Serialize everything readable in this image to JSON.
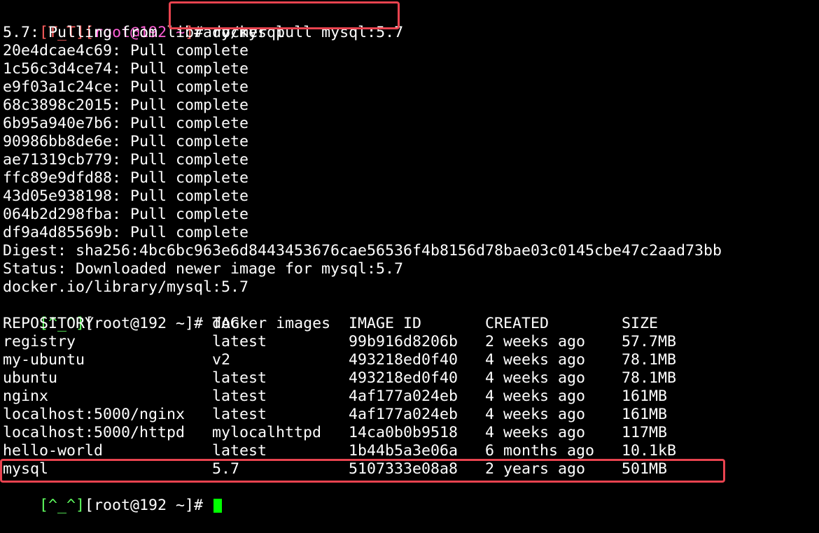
{
  "colors": {
    "background": "#000000",
    "text": "#ffffff",
    "prompt_error": "#ff5f5f",
    "prompt_error_user": "#ff5fd7",
    "prompt_ok": "#5fff5f",
    "cursor": "#00ff00",
    "highlight": "#e8434f"
  },
  "prompt1": {
    "open": "[",
    "face": "T_T",
    "close": "]",
    "user_open": "[",
    "user": "root@192 ~",
    "user_close": "]",
    "hash": "# ",
    "command": "docker pull mysql:5.7"
  },
  "pull_output": [
    "5.7: Pulling from library/mysql",
    "20e4dcae4c69: Pull complete",
    "1c56c3d4ce74: Pull complete",
    "e9f03a1c24ce: Pull complete",
    "68c3898c2015: Pull complete",
    "6b95a940e7b6: Pull complete",
    "90986bb8de6e: Pull complete",
    "ae71319cb779: Pull complete",
    "ffc89e9dfd88: Pull complete",
    "43d05e938198: Pull complete",
    "064b2d298fba: Pull complete",
    "df9a4d85569b: Pull complete",
    "Digest: sha256:4bc6bc963e6d8443453676cae56536f4b8156d78bae03c0145cbe47c2aad73bb",
    "Status: Downloaded newer image for mysql:5.7",
    "docker.io/library/mysql:5.7"
  ],
  "prompt2": {
    "face": "[^_^]",
    "user": "[root@192 ~]",
    "hash": "# ",
    "command": "docker images"
  },
  "images_table": {
    "headers": [
      "REPOSITORY",
      "TAG",
      "IMAGE ID",
      "CREATED",
      "SIZE"
    ],
    "rows": [
      [
        "registry",
        "latest",
        "99b916d8206b",
        "2 weeks ago",
        "57.7MB"
      ],
      [
        "my-ubuntu",
        "v2",
        "493218ed0f40",
        "4 weeks ago",
        "78.1MB"
      ],
      [
        "ubuntu",
        "latest",
        "493218ed0f40",
        "4 weeks ago",
        "78.1MB"
      ],
      [
        "nginx",
        "latest",
        "4af177a024eb",
        "4 weeks ago",
        "161MB"
      ],
      [
        "localhost:5000/nginx",
        "latest",
        "4af177a024eb",
        "4 weeks ago",
        "161MB"
      ],
      [
        "localhost:5000/httpd",
        "mylocalhttpd",
        "14ca0b0b9518",
        "4 weeks ago",
        "117MB"
      ],
      [
        "hello-world",
        "latest",
        "1b44b5a3e06a",
        "6 months ago",
        "10.1kB"
      ],
      [
        "mysql",
        "5.7",
        "5107333e08a8",
        "2 years ago",
        "501MB"
      ]
    ]
  },
  "prompt3": {
    "face": "[^_^]",
    "user": "[root@192 ~]",
    "hash": "# "
  }
}
